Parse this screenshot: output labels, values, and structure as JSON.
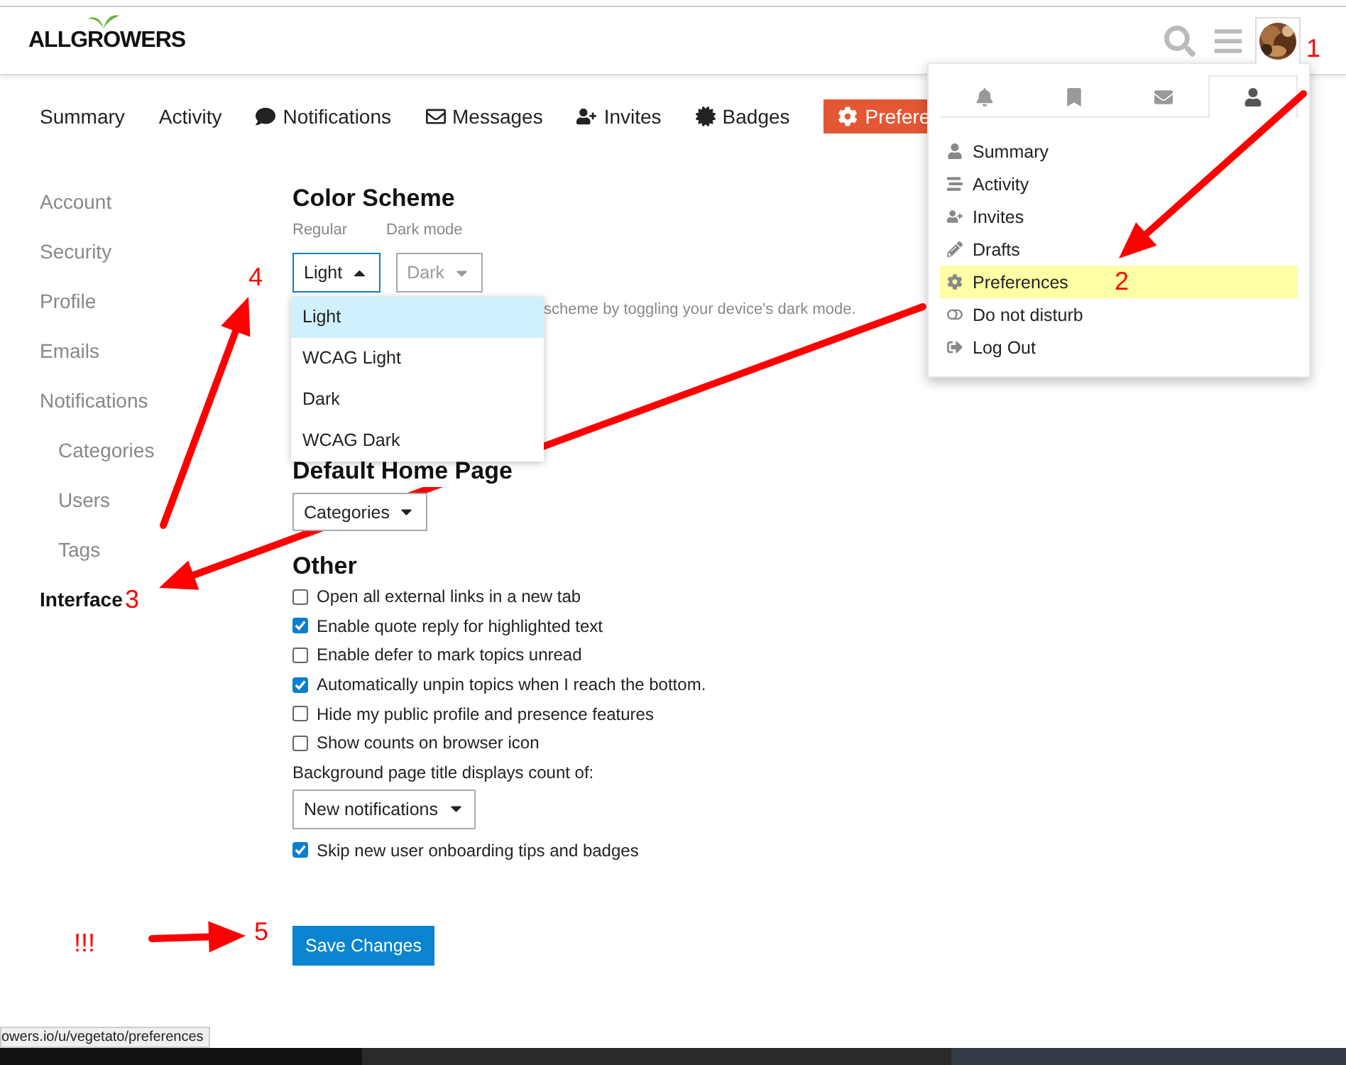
{
  "header": {
    "logo": "ALLGROWERS"
  },
  "nav": [
    {
      "label": "Summary",
      "selected": false
    },
    {
      "label": "Activity",
      "selected": false
    },
    {
      "label": "Notifications",
      "selected": false
    },
    {
      "label": "Messages",
      "selected": false
    },
    {
      "label": "Invites",
      "selected": false
    },
    {
      "label": "Badges",
      "selected": false
    },
    {
      "label": "Prefere",
      "selected": true
    }
  ],
  "user_menu": {
    "tabs": [
      {
        "selected": false
      },
      {
        "selected": false
      },
      {
        "selected": false
      },
      {
        "selected": true
      }
    ],
    "items": [
      {
        "label": "Summary",
        "selected": false
      },
      {
        "label": "Activity",
        "selected": false
      },
      {
        "label": "Invites",
        "selected": false
      },
      {
        "label": "Drafts",
        "selected": false
      },
      {
        "label": "Preferences",
        "selected": true
      },
      {
        "label": "Do not disturb",
        "selected": false
      },
      {
        "label": "Log Out",
        "selected": false
      }
    ]
  },
  "sidebar": [
    {
      "label": "Account",
      "selected": false
    },
    {
      "label": "Security",
      "selected": false
    },
    {
      "label": "Profile",
      "selected": false
    },
    {
      "label": "Emails",
      "selected": false
    },
    {
      "label": "Notifications",
      "selected": false,
      "children": [
        {
          "label": "Categories",
          "selected": false
        },
        {
          "label": "Users",
          "selected": false
        },
        {
          "label": "Tags",
          "selected": false
        }
      ]
    },
    {
      "label": "Interface",
      "selected": true
    }
  ],
  "color_scheme": {
    "title": "Color Scheme",
    "regular": {
      "label": "Regular",
      "value": "Light",
      "expanded": true,
      "options": [
        {
          "label": "Light",
          "selected": true
        },
        {
          "label": "WCAG Light",
          "selected": false
        },
        {
          "label": "Dark",
          "selected": false
        },
        {
          "label": "WCAG Dark",
          "selected": false
        }
      ]
    },
    "dark": {
      "label": "Dark mode",
      "value": "Dark",
      "disabled": true
    },
    "hint": "scheme by toggling your device's dark mode."
  },
  "home_page": {
    "title": "Default Home Page",
    "value": "Categories"
  },
  "other": {
    "title": "Other",
    "options": [
      {
        "label": "Open all external links in a new tab",
        "checked": false
      },
      {
        "label": "Enable quote reply for highlighted text",
        "checked": true
      },
      {
        "label": "Enable defer to mark topics unread",
        "checked": false
      },
      {
        "label": "Automatically unpin topics when I reach the bottom.",
        "checked": true
      },
      {
        "label": "Hide my public profile and presence features",
        "checked": false
      },
      {
        "label": "Show counts on browser icon",
        "checked": false
      }
    ],
    "count_label": "Background page title displays count of:",
    "count_value": "New notifications",
    "last_option": {
      "label": "Skip new user onboarding tips and badges",
      "checked": true
    }
  },
  "save_button": "Save Changes",
  "status_url": "owers.io/u/vegetato/preferences",
  "annotations": [
    "1",
    "2",
    "3",
    "4",
    "5",
    "!!!"
  ]
}
